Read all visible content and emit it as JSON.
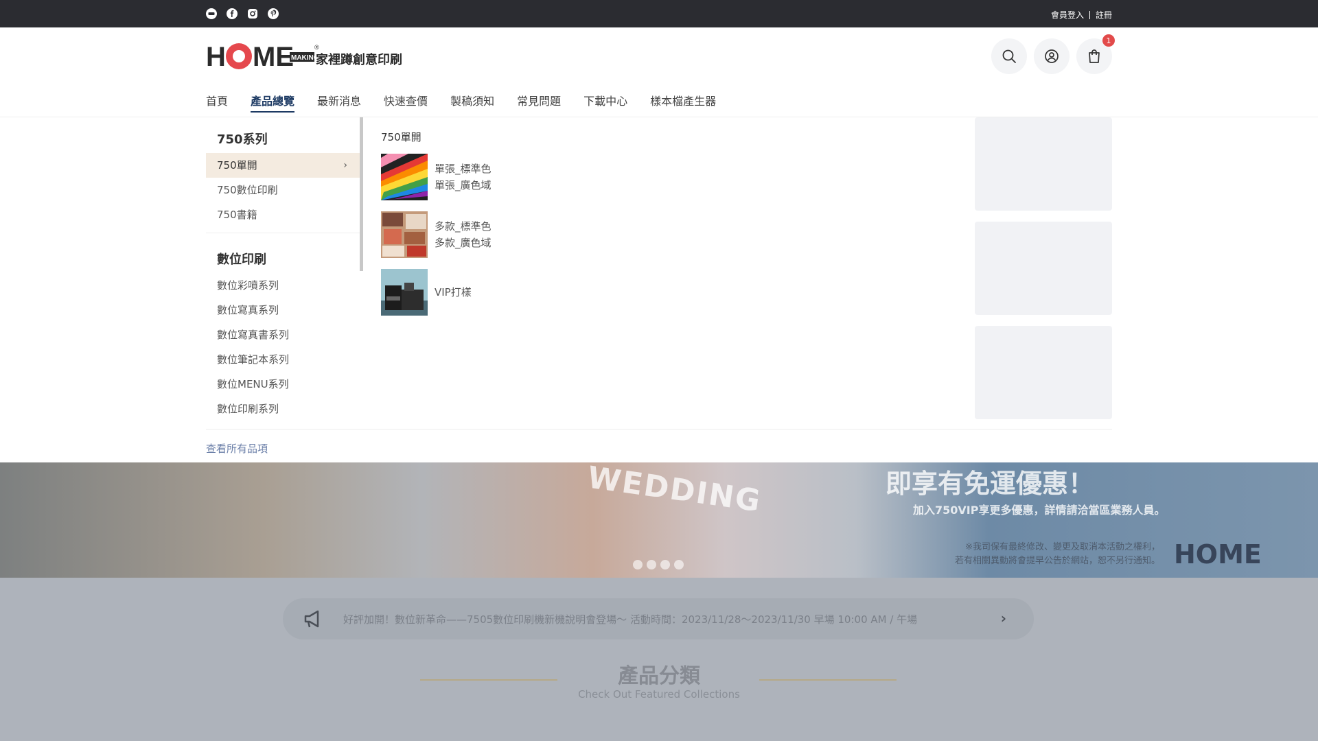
{
  "topbar": {
    "social": [
      "line-icon",
      "facebook-icon",
      "instagram-icon",
      "pinterest-icon"
    ],
    "login": "會員登入",
    "register": "註冊"
  },
  "header": {
    "logo_text": "家裡蹲創意印刷",
    "logo_brand": "HOME",
    "logo_brand_sub": "MAKING",
    "cart_count": "1"
  },
  "nav": {
    "items": [
      "首頁",
      "產品總覽",
      "最新消息",
      "快速查價",
      "製稿須知",
      "常見問題",
      "下載中心",
      "樣本檔產生器"
    ],
    "active": "產品總覽"
  },
  "menu": {
    "groups": [
      {
        "title": "750系列",
        "items": [
          "750單開",
          "750數位印刷",
          "750書籍"
        ]
      },
      {
        "title": "數位印刷",
        "items": [
          "數位彩噴系列",
          "數位寫真系列",
          "數位寫真書系列",
          "數位筆記本系列",
          "數位MENU系列",
          "數位印刷系列"
        ]
      }
    ],
    "selected": "750單開",
    "panel_title": "750單開",
    "products": [
      {
        "lines": [
          "單張_標準色",
          "單張_廣色域"
        ]
      },
      {
        "lines": [
          "多款_標準色",
          "多款_廣色域"
        ]
      },
      {
        "lines": [
          "VIP打樣"
        ]
      }
    ],
    "view_all": "查看所有品項"
  },
  "background": {
    "banner_text": "WEDDING",
    "banner_promo": "即享有免運優惠！",
    "banner_promo2": "加入750VIP享更多優惠，詳情請洽當區業務人員。",
    "banner_note1": "※我司保有最終修改、變更及取消本活動之權利，",
    "banner_note2": "若有相關異動將會提早公告於網站，恕不另行通知。",
    "notice": "好評加開！數位新革命——7505數位印刷機新機說明會登場～ 活動時間：2023/11/28～2023/11/30 早場 10:00 AM / 午場",
    "section_title": "產品分類",
    "section_sub": "Check Out Featured Collections"
  }
}
